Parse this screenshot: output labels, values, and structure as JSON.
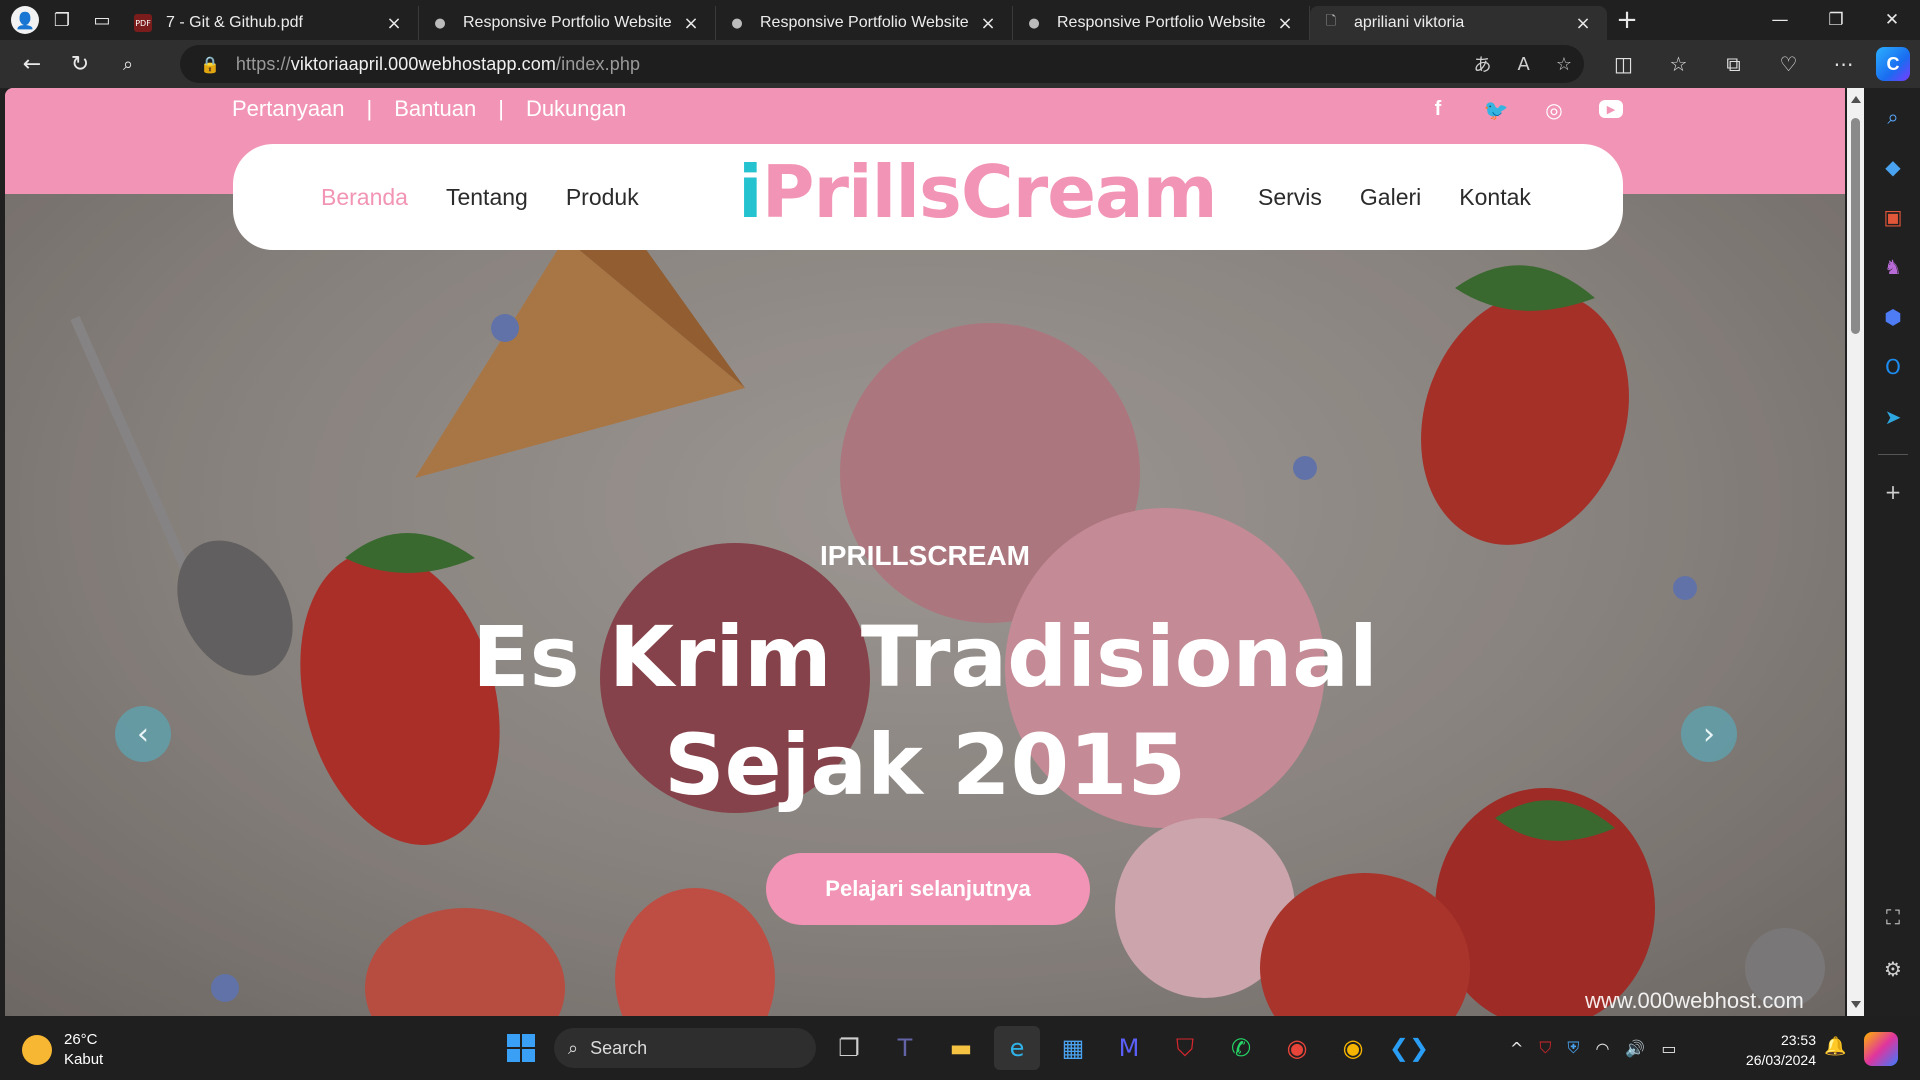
{
  "browser": {
    "tabs": [
      {
        "label": "7 - Git & Github.pdf",
        "icon": "pdf-icon",
        "active": false
      },
      {
        "label": "Responsive Portfolio Website",
        "icon": "github-icon",
        "active": false
      },
      {
        "label": "Responsive Portfolio Website",
        "icon": "github-icon",
        "active": false
      },
      {
        "label": "Responsive Portfolio Website",
        "icon": "github-icon",
        "active": false
      },
      {
        "label": "apriliani viktoria",
        "icon": "page-icon",
        "active": true
      }
    ],
    "url_prefix": "https://",
    "url_host": "viktoriaapril.000webhostapp.com",
    "url_path": "/index.php"
  },
  "site": {
    "top_links": [
      "Pertanyaan",
      "Bantuan",
      "Dukungan"
    ],
    "top_separator": "|",
    "social_icons": [
      "facebook-icon",
      "twitter-icon",
      "instagram-icon",
      "youtube-icon"
    ],
    "brand_i": "i",
    "brand_rest": "PrillsCream",
    "nav_left": [
      "Beranda",
      "Tentang",
      "Produk"
    ],
    "nav_right": [
      "Servis",
      "Galeri",
      "Kontak"
    ],
    "hero_subtitle": "IPRILLSCREAM",
    "hero_title_line1": "Es Krim Tradisional",
    "hero_title_line2": "Sejak 2015",
    "cta_label": "Pelajari selanjutnya",
    "watermark": "www.000webhost.com",
    "colors": {
      "pink": "#f294b5",
      "teal": "#25c2cf"
    }
  },
  "taskbar": {
    "temperature": "26°C",
    "weather": "Kabut",
    "search_label": "Search",
    "time": "23:53",
    "date": "26/03/2024"
  }
}
